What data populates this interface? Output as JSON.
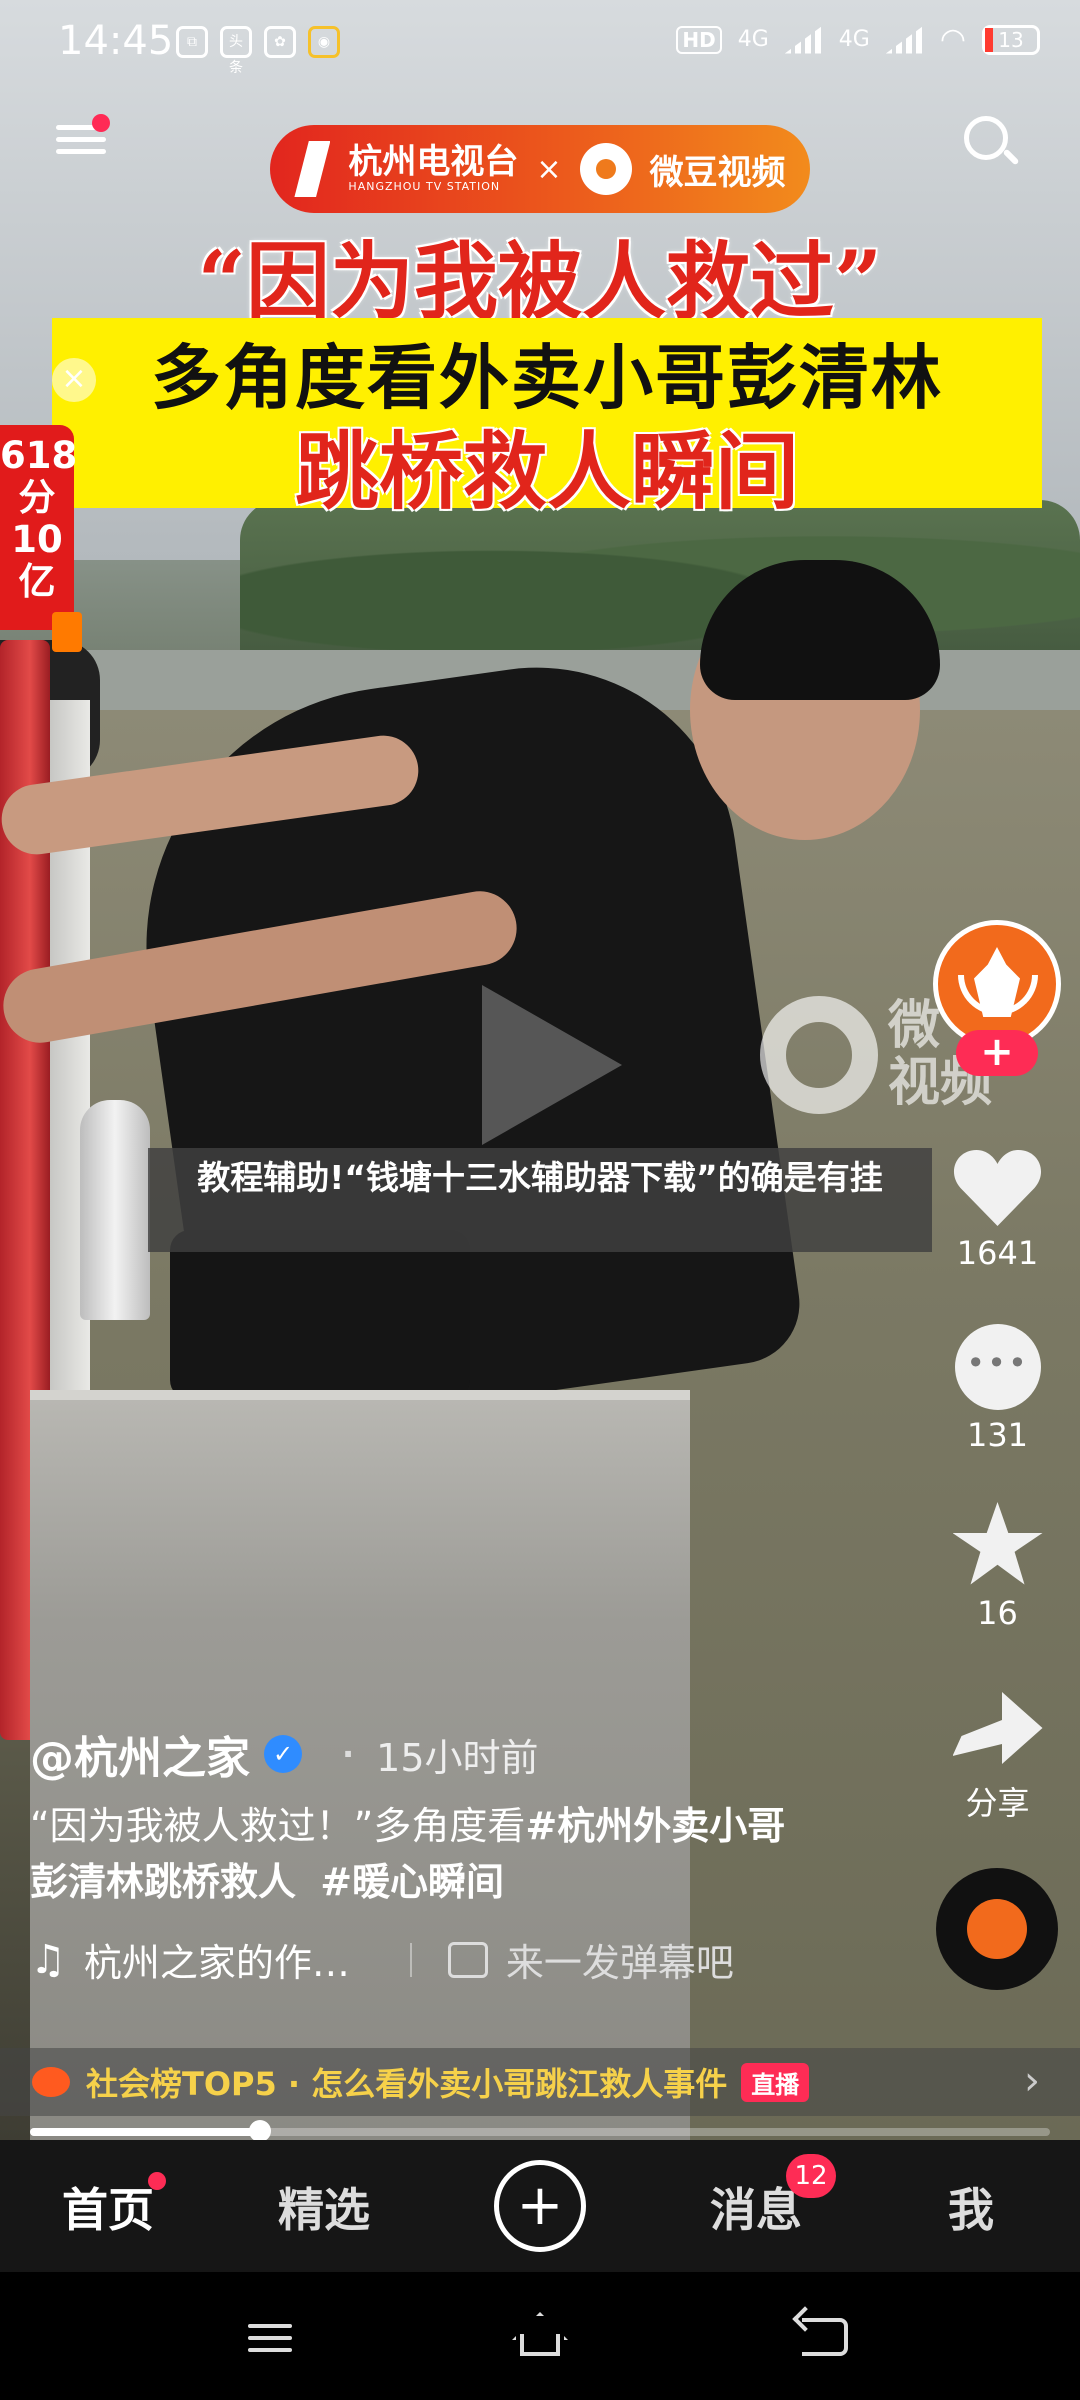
{
  "status_bar": {
    "time": "14:45",
    "notif_icons": [
      "app-icon",
      "toutiao-icon",
      "baidu-icon",
      "hotspot-icon"
    ],
    "notif_labels": [
      "",
      "头条",
      "",
      ""
    ],
    "hd_label": "HD",
    "signal_1": "4G",
    "signal_2": "4G",
    "battery": "13"
  },
  "video": {
    "brand_1": "杭州电视台",
    "brand_1_en": "HANGZHOU TV STATION",
    "brand_x": "×",
    "brand_2": "微豆视频",
    "title_line1": "“因为我被人救过”",
    "title_line2": "多角度看外卖小哥彭清林",
    "title_line3": "跳桥救人瞬间",
    "watermark": "微\n视频",
    "caption": "教程辅助!“钱塘十三水辅助器下载”的确是有挂"
  },
  "promo": {
    "text": "618\n分\n10\n亿"
  },
  "close_glyph": "×",
  "actions": {
    "follow_glyph": "+",
    "likes": "1641",
    "comments": "131",
    "favorites": "16",
    "share_label": "分享"
  },
  "info": {
    "author": "@杭州之家",
    "verified_glyph": "✓",
    "dot": "·",
    "age": "15小时前",
    "desc_plain": "“因为我被人救过！”多角度看",
    "tag1": "#杭州外卖小哥彭清林跳桥救人",
    "tag2": "#暖心瞬间",
    "music": "杭州之家的作…",
    "danmu_placeholder": "来一发弹幕吧"
  },
  "hot_topic": {
    "text": "社会榜TOP5 · 怎么看外卖小哥跳江救人事件",
    "live_label": "直播",
    "arrow": "›"
  },
  "progress": {
    "fraction": 0.225
  },
  "tabbar": {
    "home": "首页",
    "featured": "精选",
    "create_glyph": "+",
    "messages": "消息",
    "messages_badge": "12",
    "me": "我"
  },
  "colors": {
    "accent": "#fe2c55",
    "title_red": "#e1251b",
    "title_yellow": "#fff000",
    "hot_gold": "#f6d14a"
  }
}
